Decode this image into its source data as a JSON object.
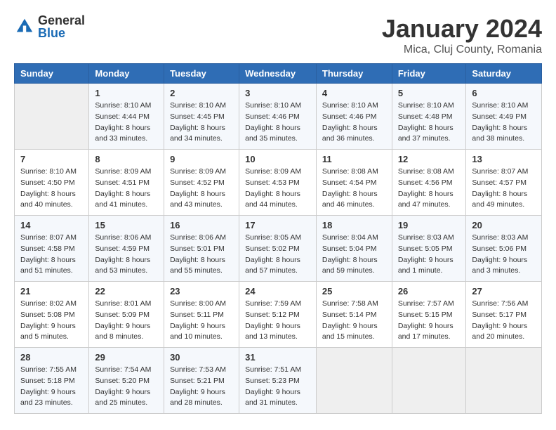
{
  "header": {
    "logo": {
      "general": "General",
      "blue": "Blue"
    },
    "title": "January 2024",
    "location": "Mica, Cluj County, Romania"
  },
  "weekdays": [
    "Sunday",
    "Monday",
    "Tuesday",
    "Wednesday",
    "Thursday",
    "Friday",
    "Saturday"
  ],
  "weeks": [
    [
      {
        "day": "",
        "info": ""
      },
      {
        "day": "1",
        "info": "Sunrise: 8:10 AM\nSunset: 4:44 PM\nDaylight: 8 hours\nand 33 minutes."
      },
      {
        "day": "2",
        "info": "Sunrise: 8:10 AM\nSunset: 4:45 PM\nDaylight: 8 hours\nand 34 minutes."
      },
      {
        "day": "3",
        "info": "Sunrise: 8:10 AM\nSunset: 4:46 PM\nDaylight: 8 hours\nand 35 minutes."
      },
      {
        "day": "4",
        "info": "Sunrise: 8:10 AM\nSunset: 4:46 PM\nDaylight: 8 hours\nand 36 minutes."
      },
      {
        "day": "5",
        "info": "Sunrise: 8:10 AM\nSunset: 4:48 PM\nDaylight: 8 hours\nand 37 minutes."
      },
      {
        "day": "6",
        "info": "Sunrise: 8:10 AM\nSunset: 4:49 PM\nDaylight: 8 hours\nand 38 minutes."
      }
    ],
    [
      {
        "day": "7",
        "info": "Sunrise: 8:10 AM\nSunset: 4:50 PM\nDaylight: 8 hours\nand 40 minutes."
      },
      {
        "day": "8",
        "info": "Sunrise: 8:09 AM\nSunset: 4:51 PM\nDaylight: 8 hours\nand 41 minutes."
      },
      {
        "day": "9",
        "info": "Sunrise: 8:09 AM\nSunset: 4:52 PM\nDaylight: 8 hours\nand 43 minutes."
      },
      {
        "day": "10",
        "info": "Sunrise: 8:09 AM\nSunset: 4:53 PM\nDaylight: 8 hours\nand 44 minutes."
      },
      {
        "day": "11",
        "info": "Sunrise: 8:08 AM\nSunset: 4:54 PM\nDaylight: 8 hours\nand 46 minutes."
      },
      {
        "day": "12",
        "info": "Sunrise: 8:08 AM\nSunset: 4:56 PM\nDaylight: 8 hours\nand 47 minutes."
      },
      {
        "day": "13",
        "info": "Sunrise: 8:07 AM\nSunset: 4:57 PM\nDaylight: 8 hours\nand 49 minutes."
      }
    ],
    [
      {
        "day": "14",
        "info": "Sunrise: 8:07 AM\nSunset: 4:58 PM\nDaylight: 8 hours\nand 51 minutes."
      },
      {
        "day": "15",
        "info": "Sunrise: 8:06 AM\nSunset: 4:59 PM\nDaylight: 8 hours\nand 53 minutes."
      },
      {
        "day": "16",
        "info": "Sunrise: 8:06 AM\nSunset: 5:01 PM\nDaylight: 8 hours\nand 55 minutes."
      },
      {
        "day": "17",
        "info": "Sunrise: 8:05 AM\nSunset: 5:02 PM\nDaylight: 8 hours\nand 57 minutes."
      },
      {
        "day": "18",
        "info": "Sunrise: 8:04 AM\nSunset: 5:04 PM\nDaylight: 8 hours\nand 59 minutes."
      },
      {
        "day": "19",
        "info": "Sunrise: 8:03 AM\nSunset: 5:05 PM\nDaylight: 9 hours\nand 1 minute."
      },
      {
        "day": "20",
        "info": "Sunrise: 8:03 AM\nSunset: 5:06 PM\nDaylight: 9 hours\nand 3 minutes."
      }
    ],
    [
      {
        "day": "21",
        "info": "Sunrise: 8:02 AM\nSunset: 5:08 PM\nDaylight: 9 hours\nand 5 minutes."
      },
      {
        "day": "22",
        "info": "Sunrise: 8:01 AM\nSunset: 5:09 PM\nDaylight: 9 hours\nand 8 minutes."
      },
      {
        "day": "23",
        "info": "Sunrise: 8:00 AM\nSunset: 5:11 PM\nDaylight: 9 hours\nand 10 minutes."
      },
      {
        "day": "24",
        "info": "Sunrise: 7:59 AM\nSunset: 5:12 PM\nDaylight: 9 hours\nand 13 minutes."
      },
      {
        "day": "25",
        "info": "Sunrise: 7:58 AM\nSunset: 5:14 PM\nDaylight: 9 hours\nand 15 minutes."
      },
      {
        "day": "26",
        "info": "Sunrise: 7:57 AM\nSunset: 5:15 PM\nDaylight: 9 hours\nand 17 minutes."
      },
      {
        "day": "27",
        "info": "Sunrise: 7:56 AM\nSunset: 5:17 PM\nDaylight: 9 hours\nand 20 minutes."
      }
    ],
    [
      {
        "day": "28",
        "info": "Sunrise: 7:55 AM\nSunset: 5:18 PM\nDaylight: 9 hours\nand 23 minutes."
      },
      {
        "day": "29",
        "info": "Sunrise: 7:54 AM\nSunset: 5:20 PM\nDaylight: 9 hours\nand 25 minutes."
      },
      {
        "day": "30",
        "info": "Sunrise: 7:53 AM\nSunset: 5:21 PM\nDaylight: 9 hours\nand 28 minutes."
      },
      {
        "day": "31",
        "info": "Sunrise: 7:51 AM\nSunset: 5:23 PM\nDaylight: 9 hours\nand 31 minutes."
      },
      {
        "day": "",
        "info": ""
      },
      {
        "day": "",
        "info": ""
      },
      {
        "day": "",
        "info": ""
      }
    ]
  ]
}
